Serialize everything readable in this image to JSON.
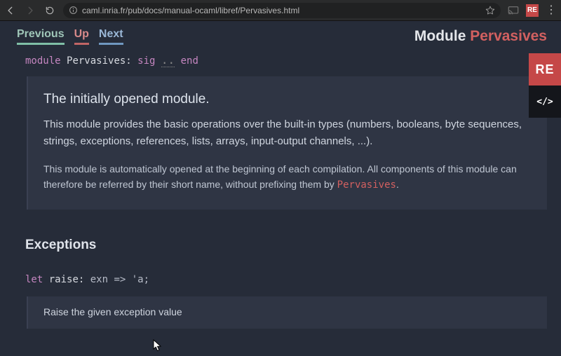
{
  "chrome": {
    "url": "caml.inria.fr/pub/docs/manual-ocaml/libref/Pervasives.html",
    "ext_badge": "RE"
  },
  "nav": {
    "prev": "Previous",
    "up": "Up",
    "next": "Next"
  },
  "title": {
    "module_word": "Module ",
    "module_name": "Pervasives"
  },
  "sig": {
    "kw_module": "module",
    "name": "Pervasives:",
    "kw_sig": "sig",
    "ellipsis": "..",
    "kw_end": "end"
  },
  "info": {
    "lead": "The initially opened module.",
    "p1": "This module provides the basic operations over the built-in types (numbers, booleans, byte sequences, strings, exceptions, references, lists, arrays, input-output channels, ...).",
    "p2a": "This module is automatically opened at the beginning of each compilation. All components of this module can therefore be referred by their short name, without prefixing them by ",
    "p2code": "Pervasives",
    "p2b": "."
  },
  "section": {
    "exceptions": "Exceptions"
  },
  "raise": {
    "kw_let": "let",
    "name": "raise:",
    "rest": " exn => 'a;"
  },
  "raise_info": "Raise the given exception value",
  "side": {
    "re": "RE",
    "code": "</>"
  }
}
